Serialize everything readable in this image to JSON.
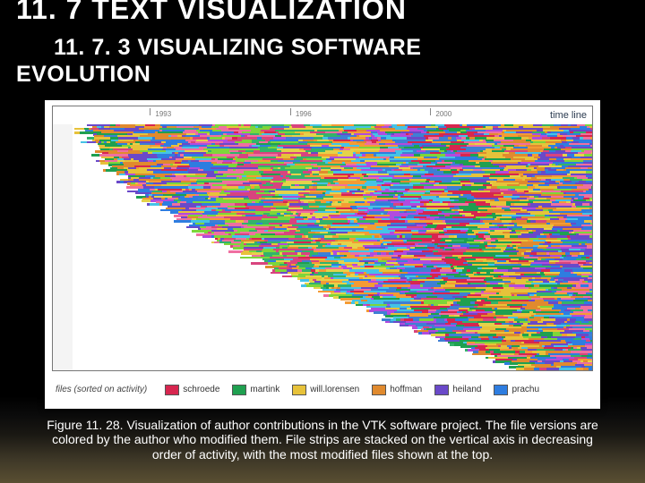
{
  "headings": {
    "h1": "11. 7 TEXT VISUALIZATION",
    "h2_prefix": "11. 7. 3 VISUALIZING SOFTWARE",
    "h2_suffix": "EVOLUTION"
  },
  "figure": {
    "timeline_label": "time line",
    "files_label": "files (sorted on activity)",
    "ticks": [
      "1993",
      "1996",
      "2000"
    ],
    "legend": [
      {
        "name": "schroede",
        "color": "#d7264f"
      },
      {
        "name": "martink",
        "color": "#1fa050"
      },
      {
        "name": "will.lorensen",
        "color": "#e7c23a"
      },
      {
        "name": "hoffman",
        "color": "#e08a2e"
      },
      {
        "name": "heiland",
        "color": "#6a49c9"
      },
      {
        "name": "prachu",
        "color": "#2e7de0"
      }
    ],
    "palette_extra": [
      "#ef6fa0",
      "#7dd63a",
      "#d8447e",
      "#33b36b",
      "#e5d24a",
      "#f49b34",
      "#45c3e6",
      "#b14bde",
      "#3f7fd4"
    ]
  },
  "caption": "Figure 11. 28. Visualization of author contributions in the VTK software project. The file versions are colored by the author who modified them. File strips are stacked on the vertical axis in decreasing order of activity, with the most modified files shown at the top."
}
